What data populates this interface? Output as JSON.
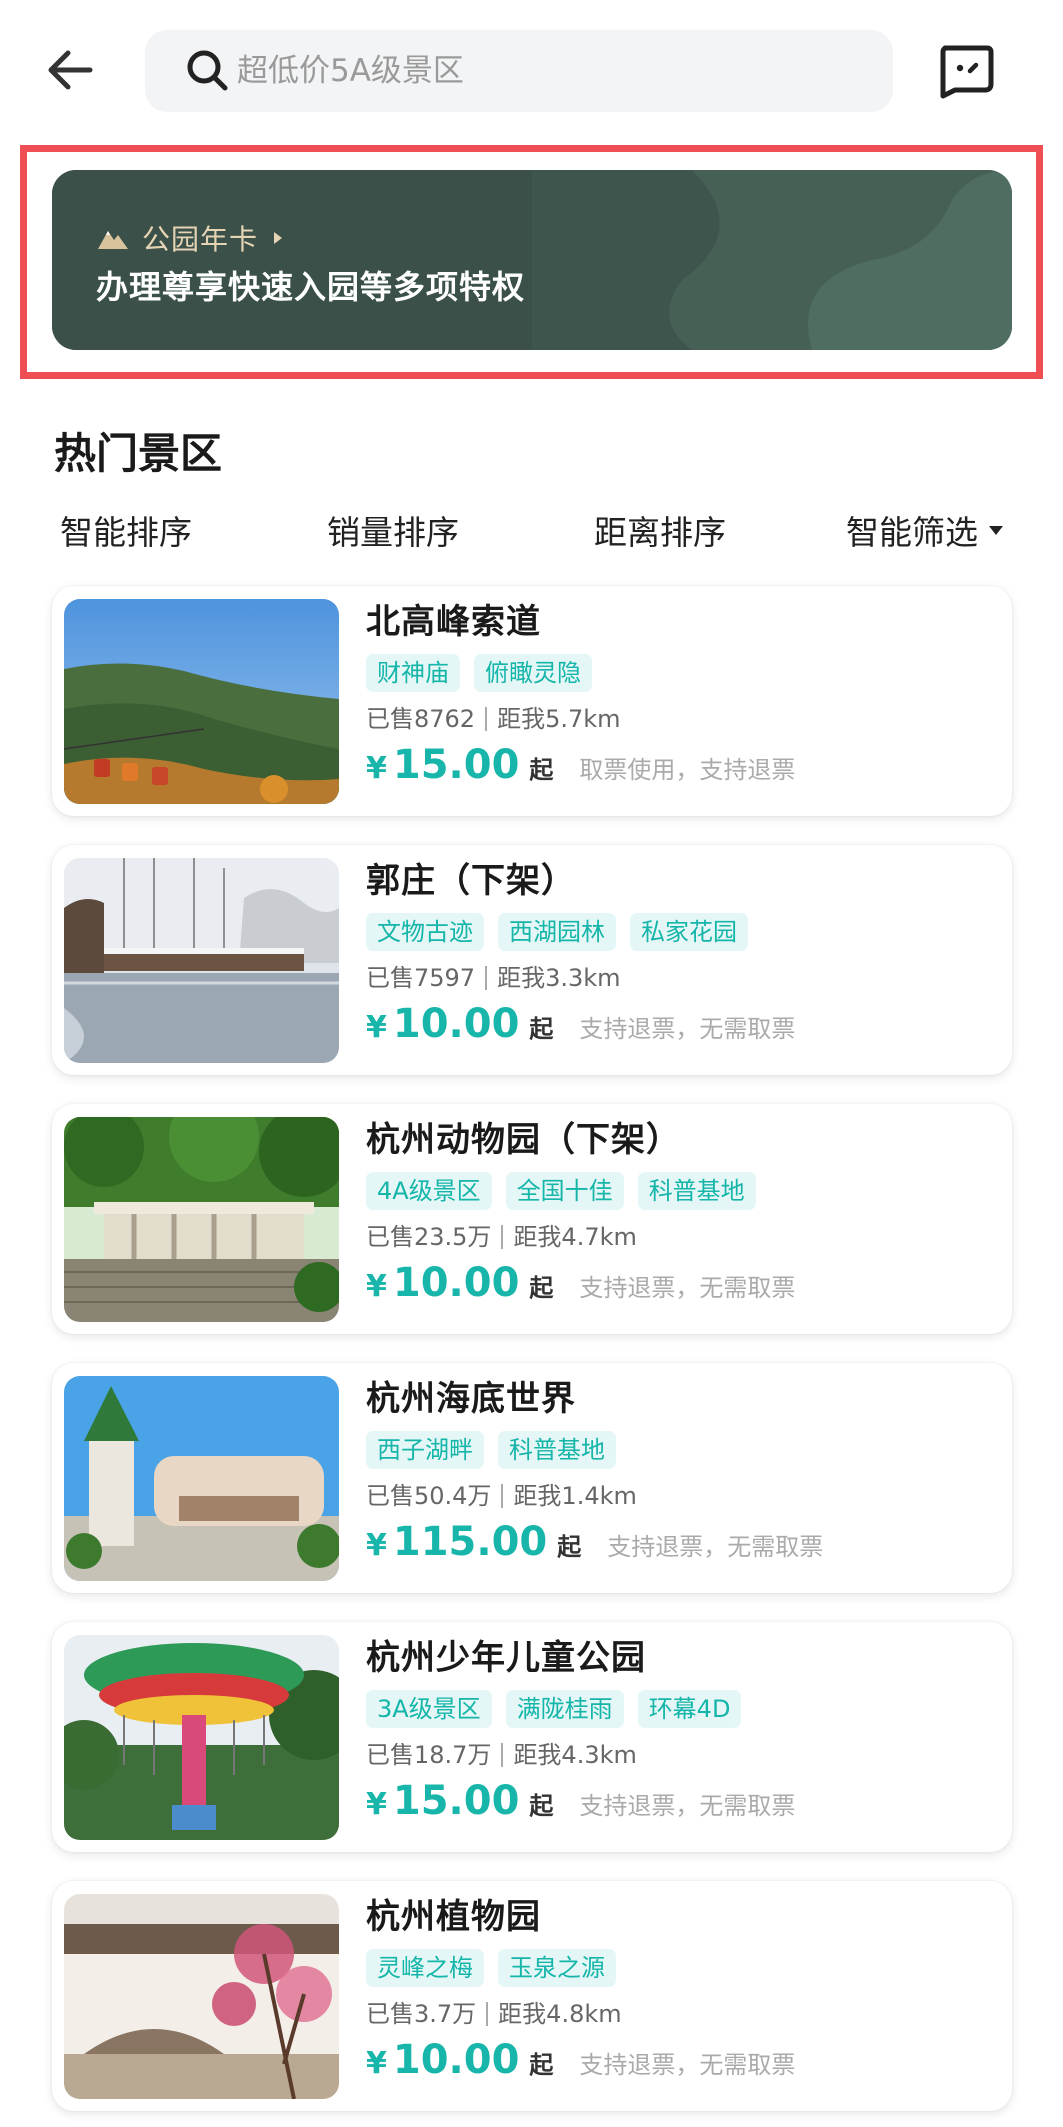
{
  "search": {
    "placeholder": "超低价5A级景区"
  },
  "banner": {
    "tag": "公园年卡",
    "title": "办理尊享快速入园等多项特权"
  },
  "section": {
    "title": "热门景区"
  },
  "sort_tabs": [
    "智能排序",
    "销量排序",
    "距离排序",
    "智能筛选"
  ],
  "cards": [
    {
      "name": "北高峰索道",
      "tags": [
        "财神庙",
        "俯瞰灵隐"
      ],
      "sold": "已售8762",
      "distance": "距我5.7km",
      "currency": "¥",
      "price": "15.00",
      "from": "起",
      "note": "取票使用，支持退票"
    },
    {
      "name": "郭庄（下架）",
      "tags": [
        "文物古迹",
        "西湖园林",
        "私家花园"
      ],
      "sold": "已售7597",
      "distance": "距我3.3km",
      "currency": "¥",
      "price": "10.00",
      "from": "起",
      "note": "支持退票，无需取票"
    },
    {
      "name": "杭州动物园（下架）",
      "tags": [
        "4A级景区",
        "全国十佳",
        "科普基地"
      ],
      "sold": "已售23.5万",
      "distance": "距我4.7km",
      "currency": "¥",
      "price": "10.00",
      "from": "起",
      "note": "支持退票，无需取票"
    },
    {
      "name": "杭州海底世界",
      "tags": [
        "西子湖畔",
        "科普基地"
      ],
      "sold": "已售50.4万",
      "distance": "距我1.4km",
      "currency": "¥",
      "price": "115.00",
      "from": "起",
      "note": "支持退票，无需取票"
    },
    {
      "name": "杭州少年儿童公园",
      "tags": [
        "3A级景区",
        "满陇桂雨",
        "环幕4D"
      ],
      "sold": "已售18.7万",
      "distance": "距我4.3km",
      "currency": "¥",
      "price": "15.00",
      "from": "起",
      "note": "支持退票，无需取票"
    },
    {
      "name": "杭州植物园",
      "tags": [
        "灵峰之梅",
        "玉泉之源"
      ],
      "sold": "已售3.7万",
      "distance": "距我4.8km",
      "currency": "¥",
      "price": "10.00",
      "from": "起",
      "note": "支持退票，无需取票"
    }
  ],
  "colors": {
    "accent": "#18b6aa",
    "tag_bg": "#e4f7f6",
    "banner_bg": "#3e554d",
    "highlight_border": "#ef4e55"
  },
  "icons": {
    "back": "arrow-left-icon",
    "search": "search-icon",
    "chat": "chat-bot-icon",
    "banner_tag": "mountain-icon",
    "sort_dropdown": "caret-down-icon"
  }
}
